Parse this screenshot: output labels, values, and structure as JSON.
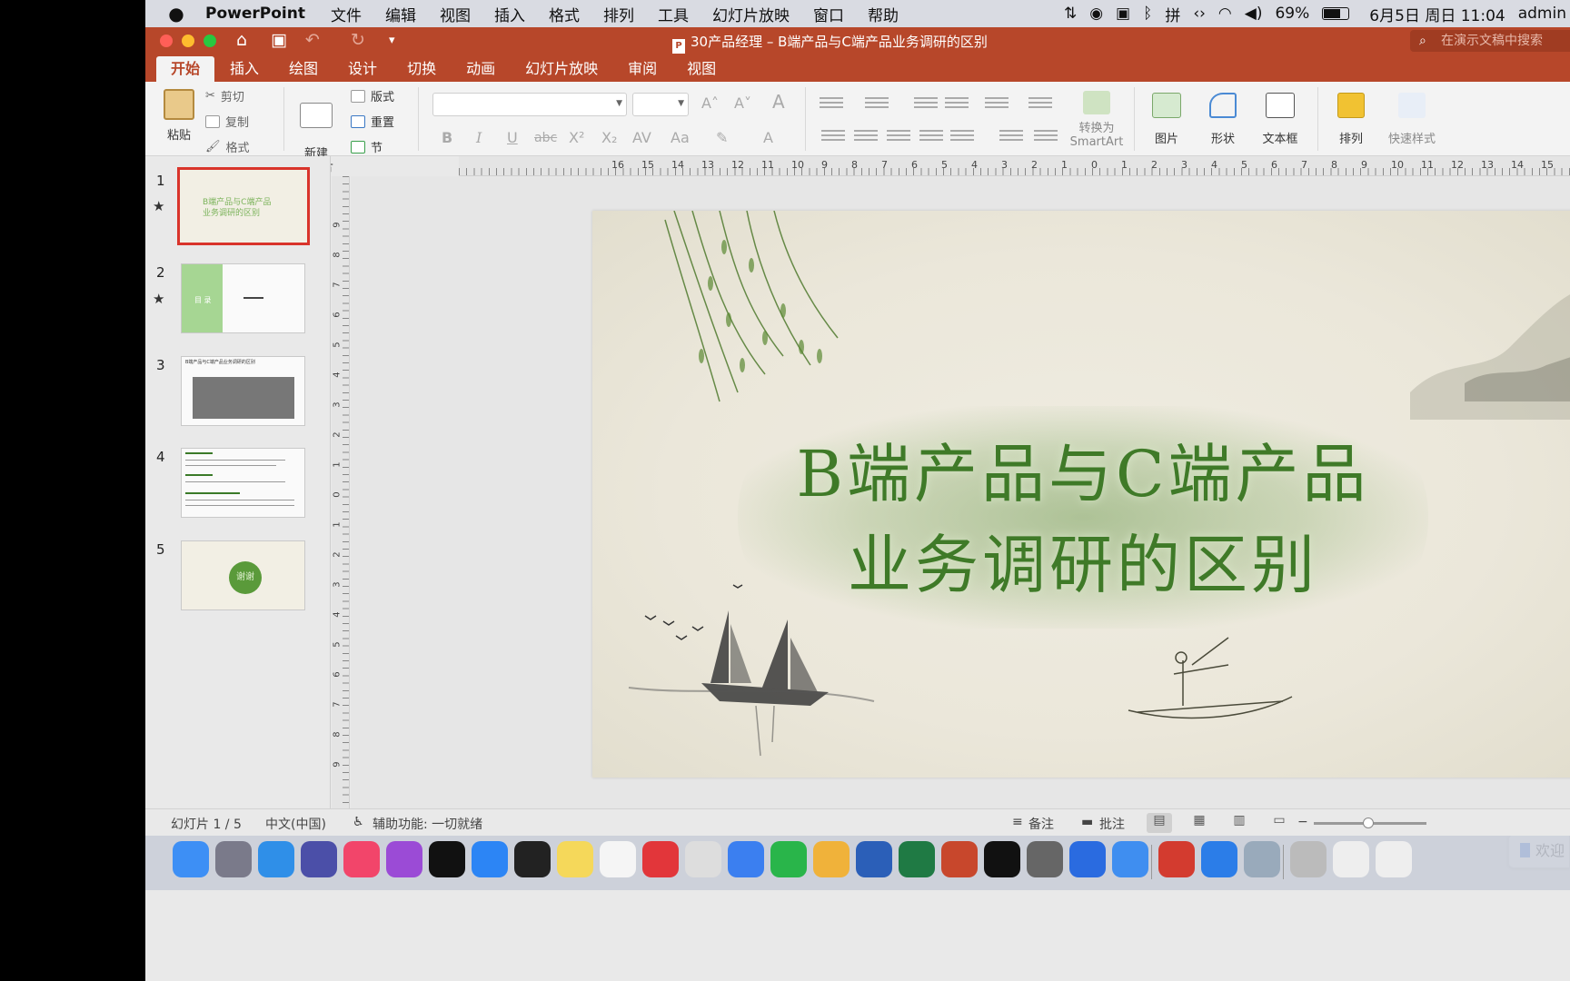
{
  "menubar": {
    "apple": "",
    "app": "PowerPoint",
    "items": [
      "文件",
      "编辑",
      "视图",
      "插入",
      "格式",
      "排列",
      "工具",
      "幻灯片放映",
      "窗口",
      "帮助"
    ],
    "battery": "69%",
    "datetime": "6月5日 周日 11:04",
    "user": "admin",
    "input_method": "拼"
  },
  "titlebar": {
    "title": "30产品经理 – B端产品与C端产品业务调研的区别",
    "search_placeholder": "在演示文稿中搜索"
  },
  "tabs": [
    "开始",
    "插入",
    "绘图",
    "设计",
    "切换",
    "动画",
    "幻灯片放映",
    "审阅",
    "视图"
  ],
  "ribbon": {
    "paste": "粘贴",
    "cut": "剪切",
    "copy": "复制",
    "format": "格式",
    "new_slide": "新建\n幻灯片",
    "layout": "版式",
    "reset": "重置",
    "section": "节",
    "bold": "B",
    "italic": "I",
    "underline": "U",
    "strike": "abc",
    "superscript": "X²",
    "subscript": "X₂",
    "convert_smartart_1": "转换为",
    "convert_smartart_2": "SmartArt",
    "picture": "图片",
    "shape": "形状",
    "textbox": "文本框",
    "arrange": "排列",
    "quick_styles": "快速样式"
  },
  "ruler_h": [
    "16",
    "15",
    "14",
    "13",
    "12",
    "11",
    "10",
    "9",
    "8",
    "7",
    "6",
    "5",
    "4",
    "3",
    "2",
    "1",
    "0",
    "1",
    "2",
    "3",
    "4",
    "5",
    "6",
    "7",
    "8",
    "9",
    "10",
    "11",
    "12",
    "13",
    "14",
    "15"
  ],
  "ruler_v": [
    "9",
    "8",
    "7",
    "6",
    "5",
    "4",
    "3",
    "2",
    "1",
    "0",
    "1",
    "2",
    "3",
    "4",
    "5",
    "6",
    "7",
    "8",
    "9"
  ],
  "thumbnails": [
    {
      "num": "1",
      "star": "★",
      "text": "B端产品与C端产品\n业务调研的区别"
    },
    {
      "num": "2",
      "star": "★",
      "text": "目 录"
    },
    {
      "num": "3",
      "star": "",
      "text": "B端产品与C端产品业务调研的区别"
    },
    {
      "num": "4",
      "star": "",
      "text": ""
    },
    {
      "num": "5",
      "star": "",
      "text": "谢谢"
    }
  ],
  "slide": {
    "title_line1": "B端产品与C端产品",
    "title_line2": "业务调研的区别",
    "welcome": "欢迎"
  },
  "status": {
    "slide_of": "幻灯片 1 / 5",
    "language": "中文(中国)",
    "accessibility": "辅助功能: 一切就绪",
    "notes": "备注",
    "comments": "批注"
  },
  "dock": [
    {
      "name": "finder-icon",
      "color": "#3d8ff5"
    },
    {
      "name": "launchpad-icon",
      "color": "#7a7a8a"
    },
    {
      "name": "safari-icon",
      "color": "#2f8fe8"
    },
    {
      "name": "teams-icon",
      "color": "#4b4fa8"
    },
    {
      "name": "music-icon",
      "color": "#f2456a"
    },
    {
      "name": "podcasts-icon",
      "color": "#9b4bd6"
    },
    {
      "name": "appletv-icon",
      "color": "#111111"
    },
    {
      "name": "appstore-icon",
      "color": "#2c85f5"
    },
    {
      "name": "terminal-icon",
      "color": "#222222"
    },
    {
      "name": "notes-icon",
      "color": "#f5d85a"
    },
    {
      "name": "qq-icon",
      "color": "#f5f5f5"
    },
    {
      "name": "xmind-icon",
      "color": "#e2363a"
    },
    {
      "name": "chrome-icon",
      "color": "#dddddd"
    },
    {
      "name": "edit-icon",
      "color": "#3b7ff0"
    },
    {
      "name": "wechat-icon",
      "color": "#29b54a"
    },
    {
      "name": "photos-icon",
      "color": "#f0b23a"
    },
    {
      "name": "word-icon",
      "color": "#2b5fb8"
    },
    {
      "name": "excel-icon",
      "color": "#1f7a44"
    },
    {
      "name": "powerpoint-icon",
      "color": "#c8472c"
    },
    {
      "name": "capcut-icon",
      "color": "#111111"
    },
    {
      "name": "robot-icon",
      "color": "#666666"
    },
    {
      "name": "xcode-icon",
      "color": "#2a6be0"
    },
    {
      "name": "feishu-icon",
      "color": "#3f8ef0"
    },
    {
      "name": "pdf-icon",
      "color": "#d33b2f"
    },
    {
      "name": "cloud-icon",
      "color": "#2b7de8"
    },
    {
      "name": "preview-icon",
      "color": "#9ab"
    },
    {
      "name": "help-icon",
      "color": "#bbbbbb"
    },
    {
      "name": "window-icon",
      "color": "#eeeeee"
    },
    {
      "name": "window2-icon",
      "color": "#eeeeee"
    }
  ]
}
